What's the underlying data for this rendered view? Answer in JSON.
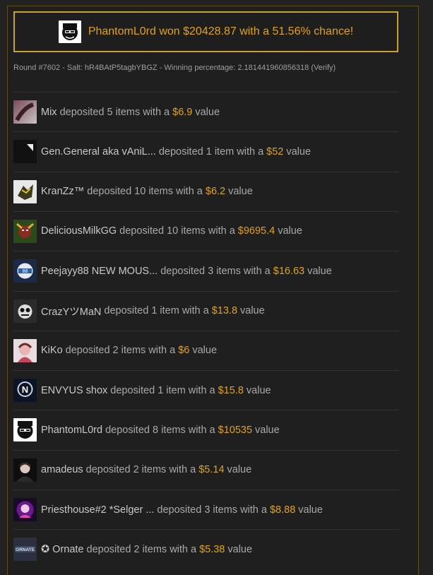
{
  "winner": {
    "text": "PhantomL0rd won $20428.87 with a 51.56% chance!"
  },
  "round_info": {
    "text": "Round #7602 - Salt: hR4BAtP5tagbYBGZ - Winning percentage: 2.181441960856318",
    "verify_label": "(Verify)"
  },
  "colors": {
    "accent": "#e0a318",
    "border": "#c9a227",
    "background": "#212121"
  },
  "deposits": [
    {
      "name": "Mix",
      "mid": "deposited 5 items with a",
      "value": "$6.9",
      "suffix": "value",
      "avatar_icon": "avatar-mix"
    },
    {
      "name": "Gen.General aka vAniL...",
      "mid": "deposited 1 item with a",
      "value": "$52",
      "suffix": "value",
      "avatar_icon": "avatar-gen-general"
    },
    {
      "name": "KranZz™",
      "mid": "deposited 10 items with a",
      "value": "$6.2",
      "suffix": "value",
      "avatar_icon": "avatar-kranzz"
    },
    {
      "name": "DeliciousMilkGG",
      "mid": "deposited 10 items with a",
      "value": "$9695.4",
      "suffix": "value",
      "avatar_icon": "avatar-deliciousmilkgg"
    },
    {
      "name": "Peejayy88 NEW MOUS...",
      "mid": "deposited 3 items with a",
      "value": "$16.63",
      "suffix": "value",
      "avatar_icon": "avatar-peejayy88"
    },
    {
      "name": "CrazYツMaN",
      "mid": "deposited 1 item with a",
      "value": "$13.8",
      "suffix": "value",
      "avatar_icon": "avatar-crazyman"
    },
    {
      "name": "KiKo",
      "mid": "deposited 2 items with a",
      "value": "$6",
      "suffix": "value",
      "avatar_icon": "avatar-kiko"
    },
    {
      "name": "ENVYUS shox",
      "mid": "deposited 1 item with a",
      "value": "$15.8",
      "suffix": "value",
      "avatar_icon": "avatar-envyus"
    },
    {
      "name": "PhantomL0rd",
      "mid": "deposited 8 items with a",
      "value": "$10535",
      "suffix": "value",
      "avatar_icon": "avatar-phantoml0rd"
    },
    {
      "name": "amadeus",
      "mid": "deposited 2 items with a",
      "value": "$5.14",
      "suffix": "value",
      "avatar_icon": "avatar-amadeus"
    },
    {
      "name": "Priesthouse#2 *Selger ...",
      "mid": "deposited 3 items with a",
      "value": "$8.88",
      "suffix": "value",
      "avatar_icon": "avatar-priesthouse"
    },
    {
      "name": "✪ Ornate",
      "mid": "deposited 2 items with a",
      "value": "$5.38",
      "suffix": "value",
      "avatar_icon": "avatar-ornate"
    }
  ]
}
